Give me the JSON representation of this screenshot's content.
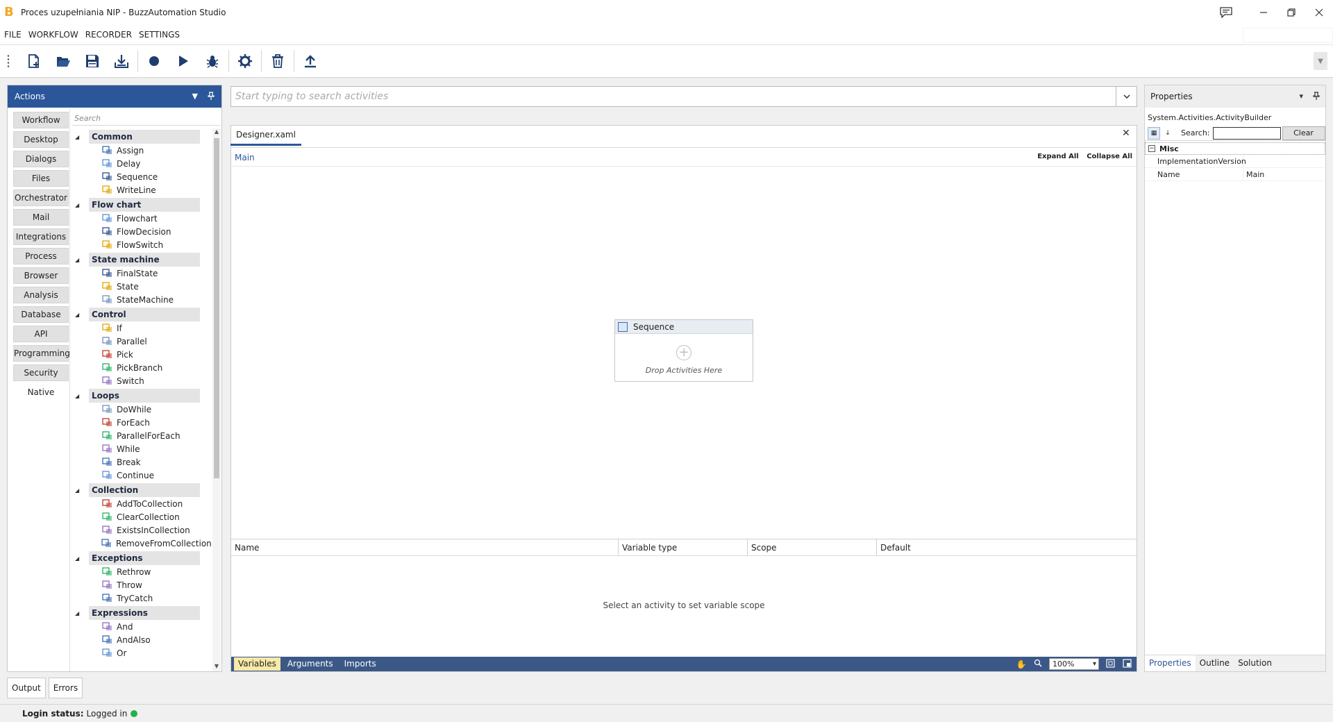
{
  "window": {
    "title": "Proces uzupełniania NIP - BuzzAutomation Studio",
    "logo_letter": "B",
    "logo_color": "#f5a623"
  },
  "menu": [
    "FILE",
    "WORKFLOW",
    "RECORDER",
    "SETTINGS"
  ],
  "toolbar": {
    "buttons": [
      "new-file-icon",
      "open-folder-icon",
      "save-icon",
      "download-icon",
      "record-icon",
      "play-icon",
      "debug-icon",
      "settings-gear-icon",
      "trash-icon",
      "publish-upload-icon"
    ]
  },
  "actions": {
    "title": "Actions",
    "search_placeholder": "Search",
    "categories": [
      "Workflow",
      "Desktop",
      "Dialogs",
      "Files",
      "Orchestrator",
      "Mail",
      "Integrations",
      "Process",
      "Browser",
      "Analysis",
      "Database",
      "API",
      "Programming",
      "Security",
      "Native"
    ],
    "groups": [
      {
        "name": "Common",
        "items": [
          {
            "label": "Assign",
            "icon": "assign-icon"
          },
          {
            "label": "Delay",
            "icon": "clock-icon"
          },
          {
            "label": "Sequence",
            "icon": "sequence-icon"
          },
          {
            "label": "WriteLine",
            "icon": "writeline-icon"
          }
        ]
      },
      {
        "name": "Flow chart",
        "items": [
          {
            "label": "Flowchart",
            "icon": "flowchart-icon"
          },
          {
            "label": "FlowDecision",
            "icon": "flowdecision-icon"
          },
          {
            "label": "FlowSwitch",
            "icon": "flowswitch-icon"
          }
        ]
      },
      {
        "name": "State machine",
        "items": [
          {
            "label": "FinalState",
            "icon": "finalstate-icon"
          },
          {
            "label": "State",
            "icon": "state-icon"
          },
          {
            "label": "StateMachine",
            "icon": "statemachine-icon"
          }
        ]
      },
      {
        "name": "Control",
        "items": [
          {
            "label": "If",
            "icon": "if-icon"
          },
          {
            "label": "Parallel",
            "icon": "parallel-icon"
          },
          {
            "label": "Pick",
            "icon": "pick-icon"
          },
          {
            "label": "PickBranch",
            "icon": "pickbranch-icon"
          },
          {
            "label": "Switch",
            "icon": "switch-icon"
          }
        ]
      },
      {
        "name": "Loops",
        "items": [
          {
            "label": "DoWhile",
            "icon": "dowhile-icon"
          },
          {
            "label": "ForEach",
            "icon": "foreach-icon"
          },
          {
            "label": "ParallelForEach",
            "icon": "parallelforeach-icon"
          },
          {
            "label": "While",
            "icon": "while-icon"
          },
          {
            "label": "Break",
            "icon": "break-icon"
          },
          {
            "label": "Continue",
            "icon": "continue-icon"
          }
        ]
      },
      {
        "name": "Collection",
        "items": [
          {
            "label": "AddToCollection",
            "icon": "addtocollection-icon"
          },
          {
            "label": "ClearCollection",
            "icon": "clearcollection-icon"
          },
          {
            "label": "ExistsInCollection",
            "icon": "existsincollection-icon"
          },
          {
            "label": "RemoveFromCollection",
            "icon": "removefromcollection-icon"
          }
        ]
      },
      {
        "name": "Exceptions",
        "items": [
          {
            "label": "Rethrow",
            "icon": "rethrow-icon"
          },
          {
            "label": "Throw",
            "icon": "throw-icon"
          },
          {
            "label": "TryCatch",
            "icon": "trycatch-icon"
          }
        ]
      },
      {
        "name": "Expressions",
        "items": [
          {
            "label": "And",
            "icon": "and-icon"
          },
          {
            "label": "AndAlso",
            "icon": "andalso-icon"
          },
          {
            "label": "Or",
            "icon": "or-icon"
          }
        ]
      }
    ]
  },
  "activity_search": {
    "placeholder": "Start typing to search activities"
  },
  "designer": {
    "tab": "Designer.xaml",
    "breadcrumb": "Main",
    "expand_all": "Expand All",
    "collapse_all": "Collapse All",
    "sequence": {
      "title": "Sequence",
      "drop_text": "Drop Activities Here"
    },
    "variables": {
      "columns": [
        "Name",
        "Variable type",
        "Scope",
        "Default"
      ],
      "empty_text": "Select an activity to set variable scope"
    },
    "footer_tabs": [
      "Variables",
      "Arguments",
      "Imports"
    ],
    "zoom": "100%"
  },
  "properties": {
    "title": "Properties",
    "object_type": "System.Activities.ActivityBuilder",
    "search_label": "Search:",
    "clear_label": "Clear",
    "category": "Misc",
    "rows": [
      {
        "name": "ImplementationVersion",
        "value": ""
      },
      {
        "name": "Name",
        "value": "Main"
      }
    ],
    "tabs": [
      "Properties",
      "Outline",
      "Solution"
    ]
  },
  "bottom_tabs": [
    "Output",
    "Errors"
  ],
  "status": {
    "label": "Login status:",
    "value": "Logged in",
    "dot_color": "#22b14c"
  }
}
